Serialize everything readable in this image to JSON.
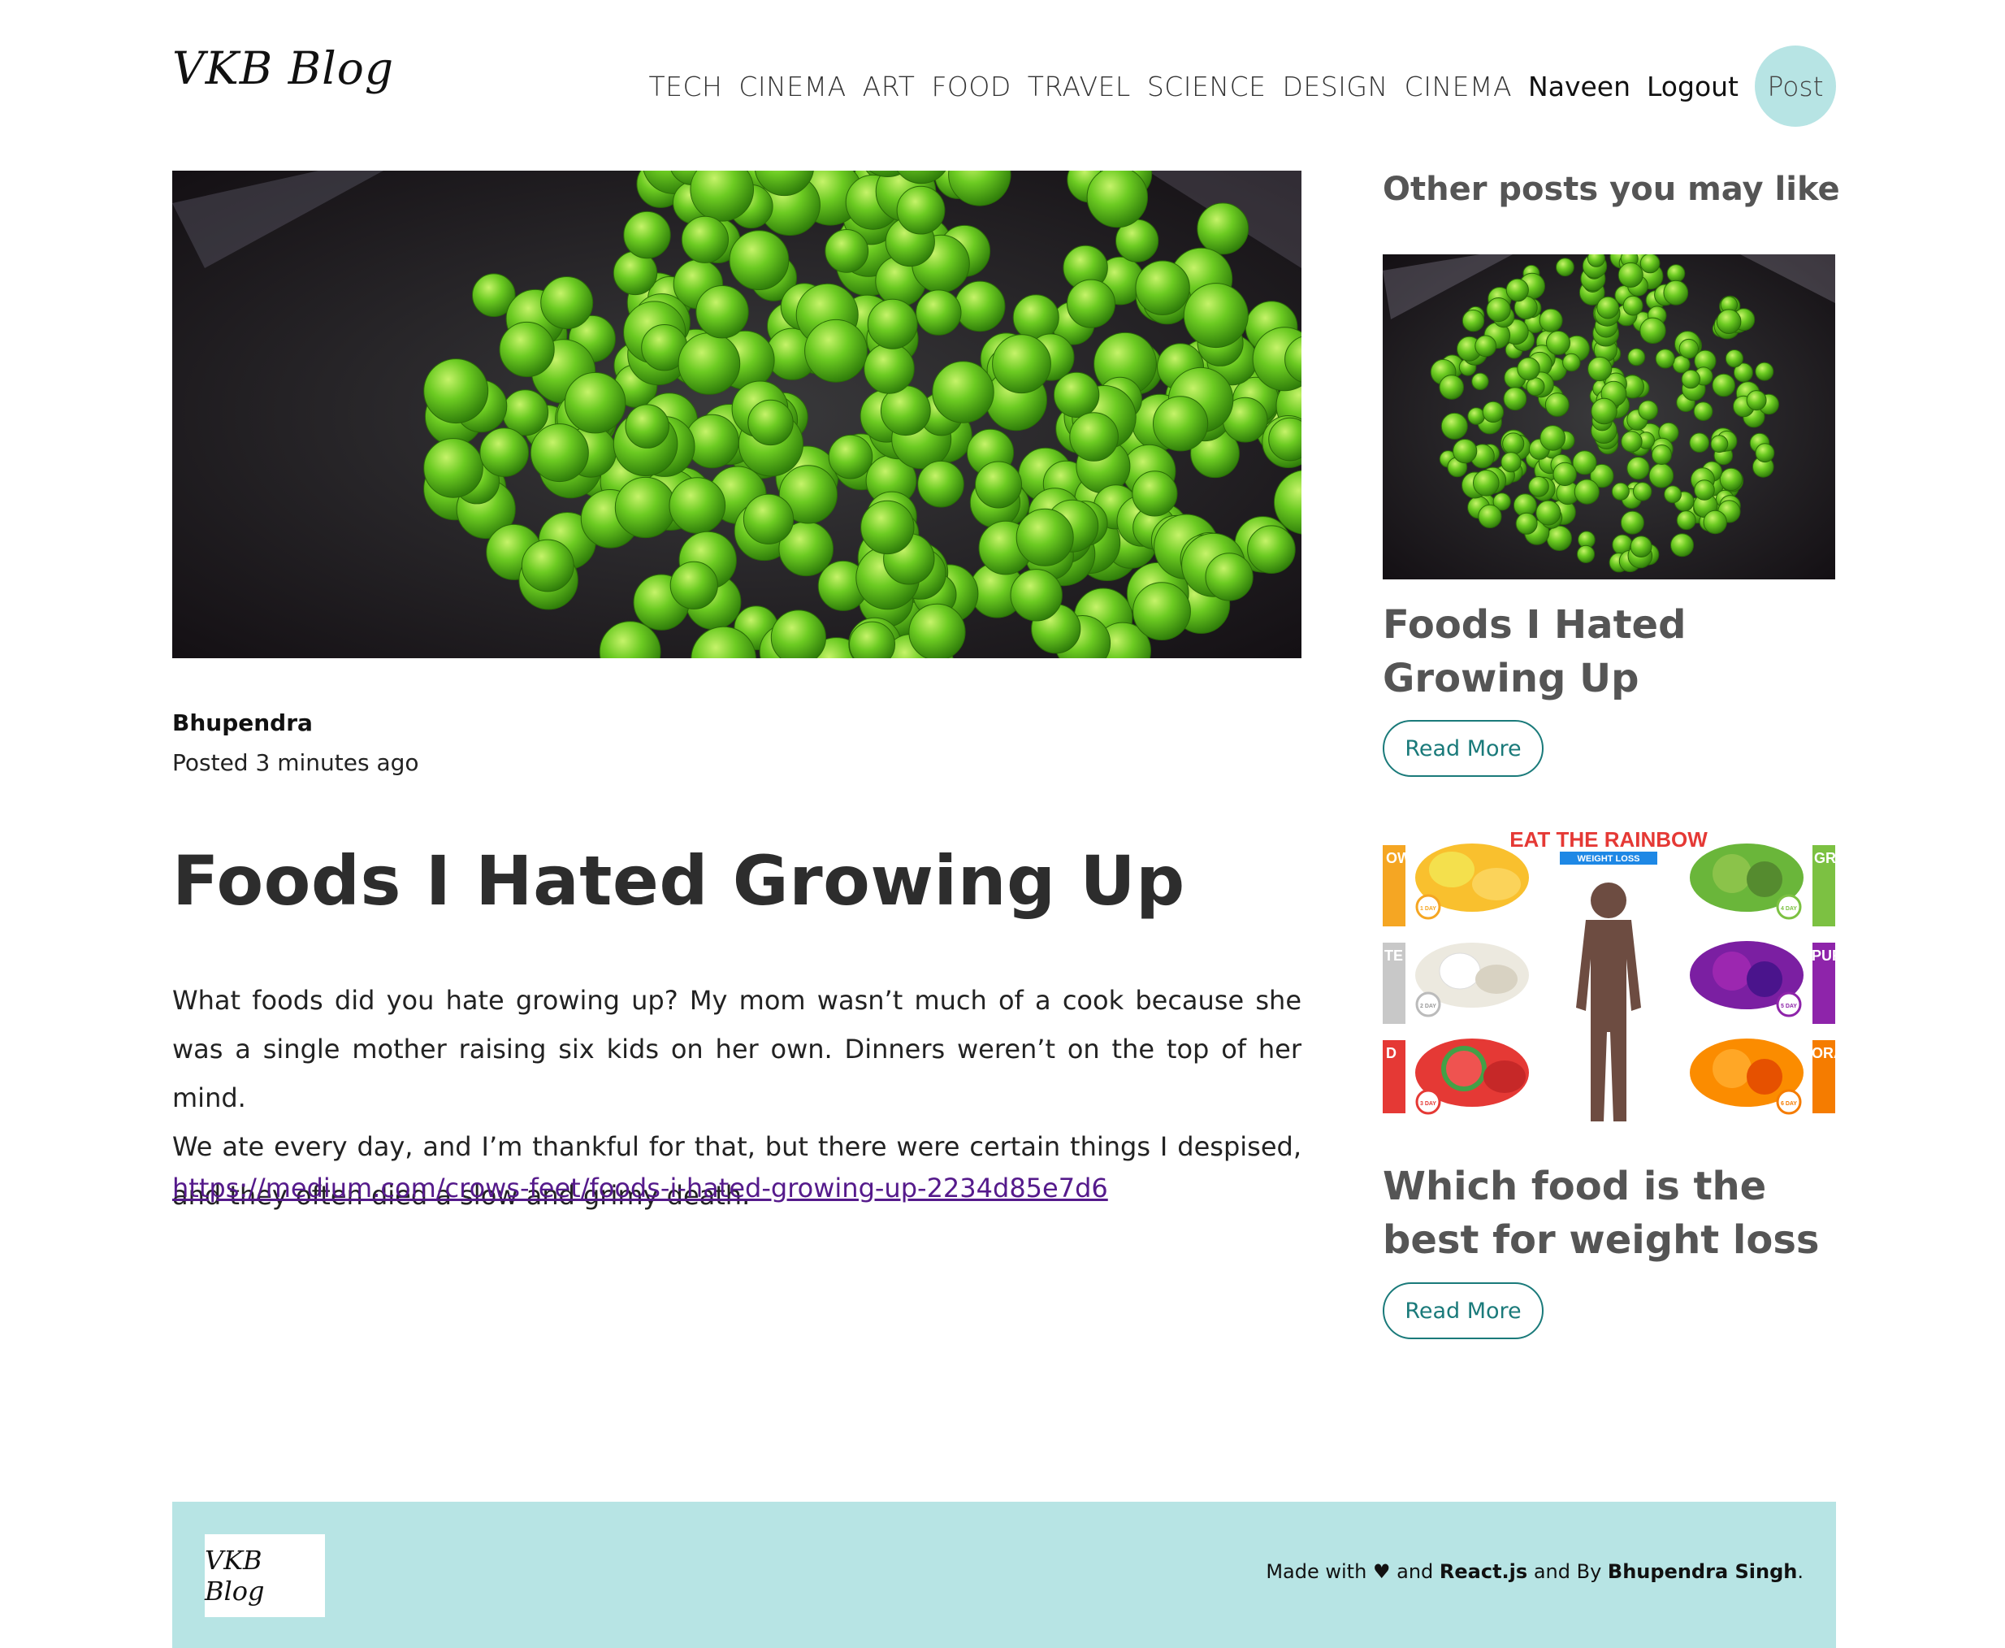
{
  "header": {
    "logo": "VKB Blog",
    "nav": [
      "TECH",
      "CINEMA",
      "ART",
      "FOOD",
      "TRAVEL",
      "SCIENCE",
      "DESIGN",
      "CINEMA"
    ],
    "user": "Naveen",
    "logout": "Logout",
    "post": "Post"
  },
  "article": {
    "author": "Bhupendra",
    "posted": "Posted 3 minutes ago",
    "title": "Foods I Hated Growing Up",
    "paragraphs": [
      "What foods did you hate growing up? My mom wasn’t much of a cook because she was a single mother raising six kids on her own. Dinners weren’t on the top of her mind.",
      "We ate every day, and I’m thankful for that, but there were certain things I despised, and they often died a slow and grimy death."
    ],
    "link": "https://medium.com/crows-feet/foods-i-hated-growing-up-2234d85e7d6"
  },
  "sidebar": {
    "heading": "Other posts you may like",
    "cards": [
      {
        "title": "Foods I Hated Growing Up",
        "button": "Read More"
      },
      {
        "title": "Which food is the best for weight loss",
        "button": "Read More",
        "image_text": {
          "banner": "EAT THE RAINBOW",
          "subbanner": "WEIGHT LOSS",
          "labels": [
            "OW",
            "GR",
            "TE",
            "PUR",
            "D",
            "ORA"
          ],
          "days": [
            "1 DAY",
            "2 DAY",
            "3 DAY",
            "4 DAY",
            "5 DAY",
            "6 DAY"
          ]
        }
      }
    ]
  },
  "footer": {
    "logo": "VKB Blog",
    "made_with": "Made with",
    "heart": "♥",
    "and": "and",
    "tech": "React.js",
    "and_by": "and By",
    "author": "Bhupendra Singh",
    "period": "."
  },
  "colors": {
    "accent": "#b7e4e4",
    "button_border": "#1a7a7a",
    "link": "#551a8b",
    "pea_green": "#6cc62a"
  },
  "icons": [
    "heart-icon"
  ]
}
